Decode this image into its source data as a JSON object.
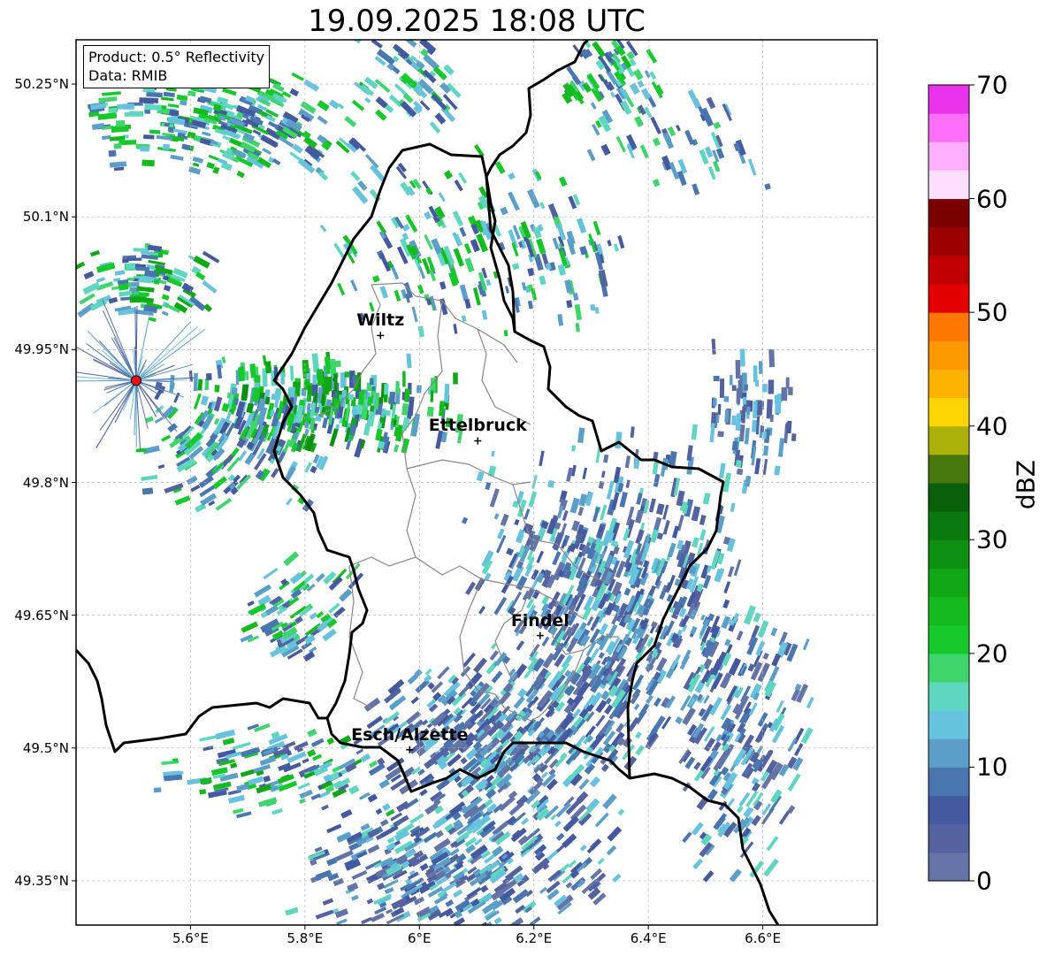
{
  "title": "19.09.2025 18:08 UTC",
  "product_box": {
    "line1": "Product: 0.5° Reflectivity",
    "line2": "Data: RMIB"
  },
  "extent": {
    "lon": [
      5.4,
      6.8
    ],
    "lat": [
      49.3,
      50.3
    ]
  },
  "lat_ticks": [
    {
      "value": 50.25,
      "label": "50.25°N"
    },
    {
      "value": 50.1,
      "label": "50.1°N"
    },
    {
      "value": 49.95,
      "label": "49.95°N"
    },
    {
      "value": 49.8,
      "label": "49.8°N"
    },
    {
      "value": 49.65,
      "label": "49.65°N"
    },
    {
      "value": 49.5,
      "label": "49.5°N"
    },
    {
      "value": 49.35,
      "label": "49.35°N"
    }
  ],
  "lon_ticks": [
    {
      "value": 5.6,
      "label": "5.6°E"
    },
    {
      "value": 5.8,
      "label": "5.8°E"
    },
    {
      "value": 6.0,
      "label": "6°E"
    },
    {
      "value": 6.2,
      "label": "6.2°E"
    },
    {
      "value": 6.4,
      "label": "6.4°E"
    },
    {
      "value": 6.6,
      "label": "6.6°E"
    }
  ],
  "cities": [
    {
      "name": "Wiltz",
      "lon": 5.932,
      "lat": 49.966
    },
    {
      "name": "Ettelbruck",
      "lon": 6.102,
      "lat": 49.847
    },
    {
      "name": "Findel",
      "lon": 6.211,
      "lat": 49.627
    },
    {
      "name": "Esch/Alzette",
      "lon": 5.983,
      "lat": 49.498
    }
  ],
  "radar_site": {
    "lon": 5.505,
    "lat": 49.915,
    "color": "#ee1111"
  },
  "colorbar": {
    "label": "dBZ",
    "min": 0,
    "max": 70,
    "ticks": [
      {
        "value": 0,
        "label": "0"
      },
      {
        "value": 10,
        "label": "10"
      },
      {
        "value": 20,
        "label": "20"
      },
      {
        "value": 30,
        "label": "30"
      },
      {
        "value": 40,
        "label": "40"
      },
      {
        "value": 50,
        "label": "50"
      },
      {
        "value": 60,
        "label": "60"
      },
      {
        "value": 70,
        "label": "70"
      }
    ],
    "colors": [
      "#6474a6",
      "#5463a0",
      "#44599f",
      "#4a76b0",
      "#5b9ec8",
      "#67c3dd",
      "#5fd6c0",
      "#3fd56c",
      "#15c92a",
      "#14ba1e",
      "#10a717",
      "#0d8f12",
      "#0b7a0e",
      "#095f0b",
      "#46780c",
      "#acb10a",
      "#fdd500",
      "#fdb100",
      "#fd9800",
      "#fe7800",
      "#e40000",
      "#c00000",
      "#9c0000",
      "#7a0000",
      "#ffdfff",
      "#ffb0ff",
      "#ff6ffa",
      "#ea32ea"
    ]
  },
  "colors": {
    "border": "#000000",
    "cantons": "#888888",
    "grid": "#b4b4b4"
  }
}
